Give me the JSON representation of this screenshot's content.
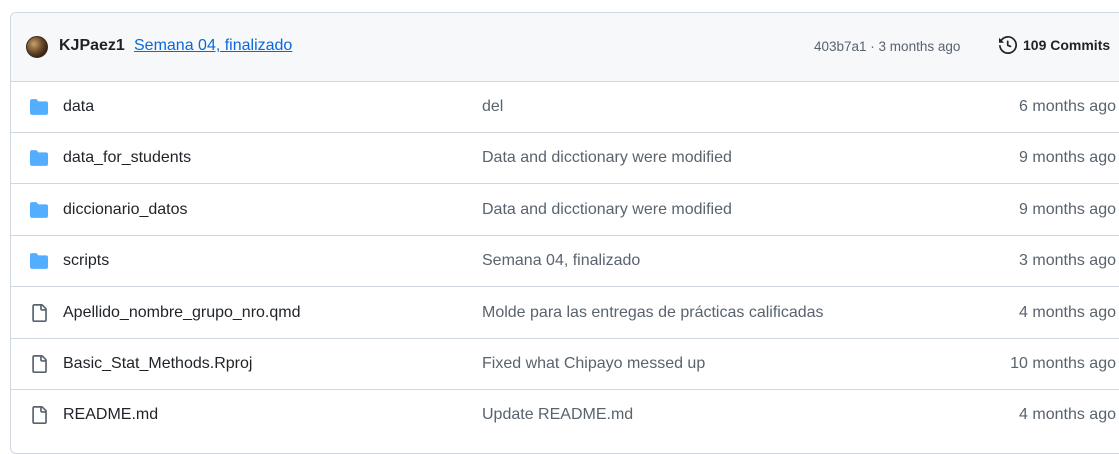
{
  "latest_commit": {
    "author": "KJPaez1",
    "message": "Semana 04, finalizado",
    "hash_time": "403b7a1 · 3 months ago",
    "commits_label": "109 Commits"
  },
  "files": [
    {
      "type": "folder",
      "name": "data",
      "message": "del",
      "time": "6 months ago"
    },
    {
      "type": "folder",
      "name": "data_for_students",
      "message": "Data and dicctionary were modified",
      "time": "9 months ago"
    },
    {
      "type": "folder",
      "name": "diccionario_datos",
      "message": "Data and dicctionary were modified",
      "time": "9 months ago"
    },
    {
      "type": "folder",
      "name": "scripts",
      "message": "Semana 04, finalizado",
      "time": "3 months ago"
    },
    {
      "type": "file",
      "name": "Apellido_nombre_grupo_nro.qmd",
      "message": "Molde para las entregas de prácticas calificadas",
      "time": "4 months ago"
    },
    {
      "type": "file",
      "name": "Basic_Stat_Methods.Rproj",
      "message": "Fixed what Chipayo messed up",
      "time": "10 months ago"
    },
    {
      "type": "file",
      "name": "README.md",
      "message": "Update README.md",
      "time": "4 months ago"
    }
  ],
  "colors": {
    "folder": "#54aeff",
    "link": "#0969da",
    "muted": "#59636e",
    "border": "#d0d7de",
    "header_bg": "#f6f8fa"
  }
}
